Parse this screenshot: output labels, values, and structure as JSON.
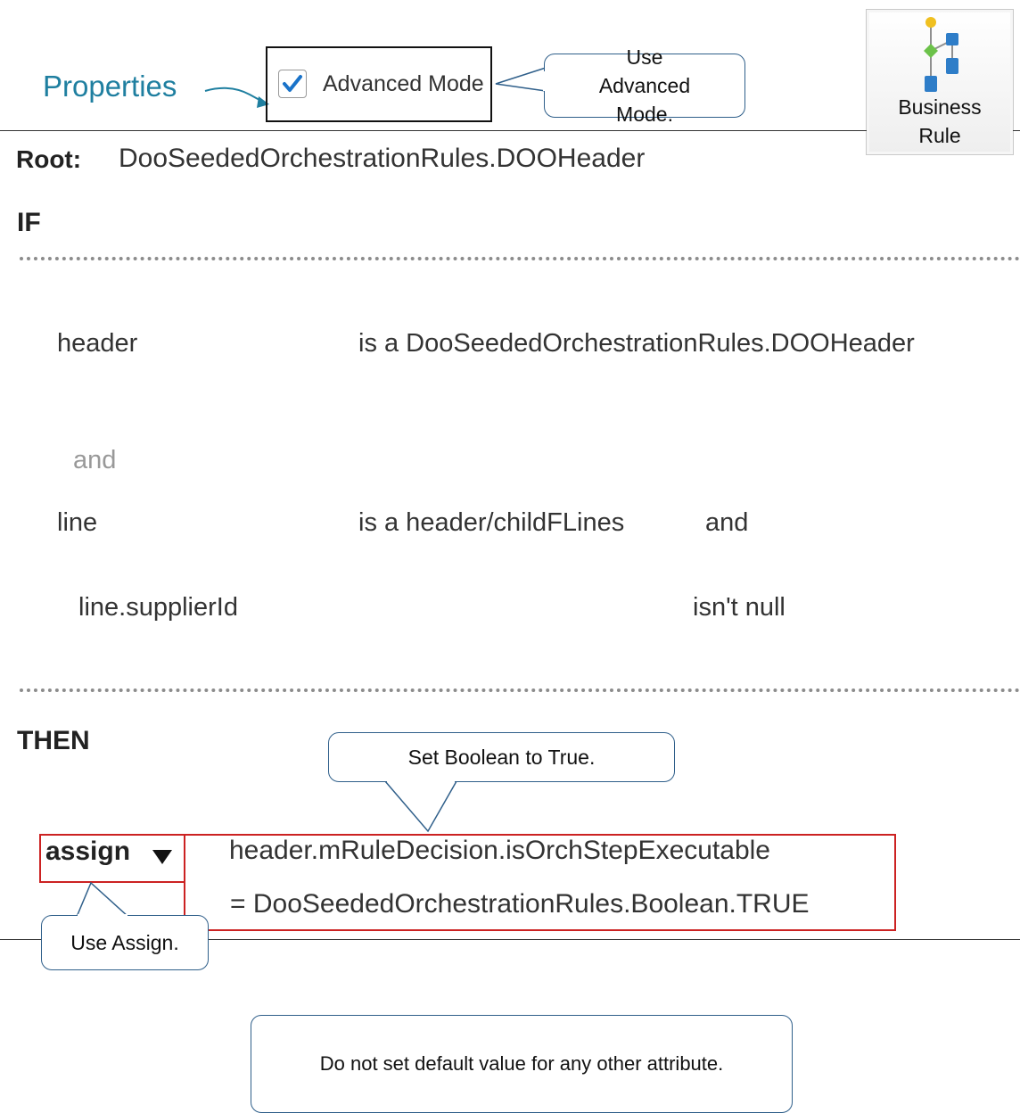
{
  "properties_label": "Properties",
  "advanced_mode": {
    "label": "Advanced Mode",
    "checked": true
  },
  "callouts": {
    "advanced": "Use Advanced Mode.",
    "boolean": "Set Boolean to True.",
    "assign": "Use Assign.",
    "default_value": "Do not set default value for any other attribute."
  },
  "business_rule_button": {
    "line1": "Business",
    "line2": "Rule",
    "icon": "business-rule-icon"
  },
  "root": {
    "label": "Root:",
    "value": "DooSeededOrchestrationRules.DOOHeader"
  },
  "if_label": "IF",
  "then_label": "THEN",
  "conditions": {
    "header_var": "header",
    "header_type": "is a DooSeededOrchestrationRules.DOOHeader",
    "and_label": "and",
    "line_var": "line",
    "line_type": "is a header/childFLines",
    "line_and": "and",
    "supplier_field": "line.supplierId",
    "supplier_op": "isn't null"
  },
  "action": {
    "type": "assign",
    "target": "header.mRuleDecision.isOrchStepExecutable",
    "value": "= DooSeededOrchestrationRules.Boolean.TRUE"
  },
  "colors": {
    "accent": "#1f7fa0",
    "callout_border": "#2f5f8a",
    "highlight": "#cc2222",
    "checkbox": "#1a73c9"
  }
}
